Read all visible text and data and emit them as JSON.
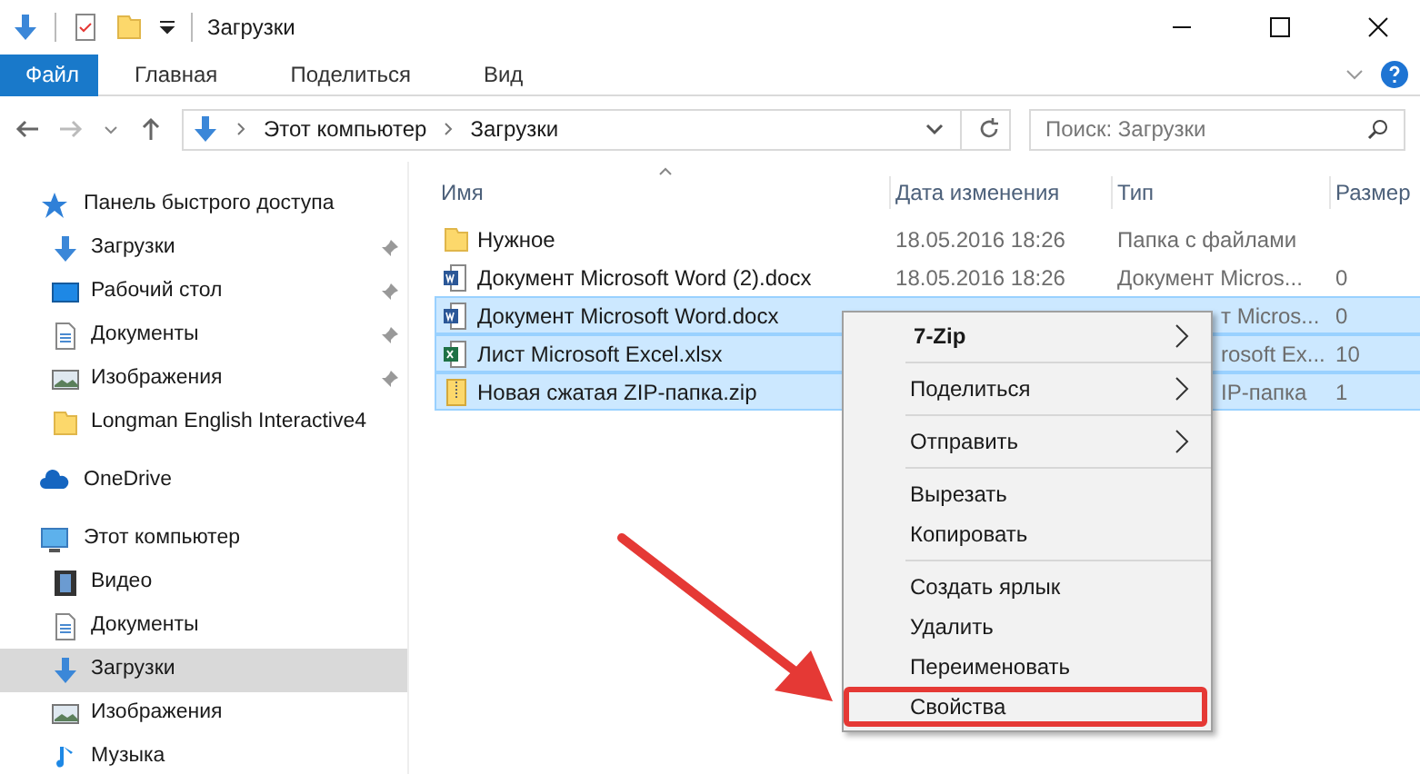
{
  "window": {
    "title": "Загрузки"
  },
  "ribbon_tabs": [
    {
      "label": "Файл",
      "selected": true
    },
    {
      "label": "Главная",
      "selected": false
    },
    {
      "label": "Поделиться",
      "selected": false
    },
    {
      "label": "Вид",
      "selected": false
    }
  ],
  "address_bar": {
    "path": [
      "Этот компьютер",
      "Загрузки"
    ]
  },
  "search": {
    "placeholder": "Поиск: Загрузки"
  },
  "sidebar": {
    "sections": [
      {
        "label": "Панель быстрого доступа",
        "kind": "star",
        "children": [
          {
            "label": "Загрузки",
            "kind": "download",
            "pinned": true,
            "selected": false
          },
          {
            "label": "Рабочий стол",
            "kind": "desktop",
            "pinned": true,
            "selected": false
          },
          {
            "label": "Документы",
            "kind": "document",
            "pinned": true,
            "selected": false
          },
          {
            "label": "Изображения",
            "kind": "image",
            "pinned": true,
            "selected": false
          },
          {
            "label": "Longman English Interactive4",
            "kind": "folder",
            "pinned": false,
            "selected": false
          }
        ]
      },
      {
        "label": "OneDrive",
        "kind": "cloud"
      },
      {
        "label": "Этот компьютер",
        "kind": "computer",
        "children": [
          {
            "label": "Видео",
            "kind": "video",
            "pinned": false,
            "selected": false
          },
          {
            "label": "Документы",
            "kind": "document",
            "pinned": false,
            "selected": false
          },
          {
            "label": "Загрузки",
            "kind": "download",
            "pinned": false,
            "selected": true
          },
          {
            "label": "Изображения",
            "kind": "image",
            "pinned": false,
            "selected": false
          },
          {
            "label": "Музыка",
            "kind": "music",
            "pinned": false,
            "selected": false
          }
        ]
      }
    ]
  },
  "table": {
    "columns": [
      "Имя",
      "Дата изменения",
      "Тип",
      "Размер"
    ],
    "rows": [
      {
        "name": "Нужное",
        "kind": "folder",
        "date": "18.05.2016 18:26",
        "type": "Папка с файлами",
        "selected": false
      },
      {
        "name": "Документ Microsoft Word (2).docx",
        "kind": "word",
        "date": "18.05.2016 18:26",
        "type": "Документ Micros...",
        "size": "0",
        "selected": false
      },
      {
        "name": "Документ Microsoft Word.docx",
        "kind": "word",
        "type": "т Micros...",
        "size": "0",
        "selected": true
      },
      {
        "name": "Лист Microsoft Excel.xlsx",
        "kind": "excel",
        "type": "rosoft Ex...",
        "size": "10",
        "selected": true
      },
      {
        "name": "Новая сжатая ZIP-папка.zip",
        "kind": "zip",
        "type": "IP-папка",
        "size": "1",
        "selected": true
      }
    ]
  },
  "context_menu": {
    "groups": [
      [
        {
          "label": "7-Zip",
          "bold": true,
          "submenu": true,
          "highlighted": false
        }
      ],
      [
        {
          "label": "Поделиться",
          "bold": false,
          "submenu": true,
          "highlighted": false
        }
      ],
      [
        {
          "label": "Отправить",
          "bold": false,
          "submenu": true,
          "highlighted": false
        }
      ],
      [
        {
          "label": "Вырезать",
          "bold": false,
          "submenu": false,
          "highlighted": false
        },
        {
          "label": "Копировать",
          "bold": false,
          "submenu": false,
          "highlighted": false
        }
      ],
      [
        {
          "label": "Создать ярлык",
          "bold": false,
          "submenu": false,
          "highlighted": false
        },
        {
          "label": "Удалить",
          "bold": false,
          "submenu": false,
          "highlighted": false
        },
        {
          "label": "Переименовать",
          "bold": false,
          "submenu": false,
          "highlighted": false
        },
        {
          "label": "Свойства",
          "bold": false,
          "submenu": false,
          "highlighted": true
        }
      ]
    ]
  }
}
